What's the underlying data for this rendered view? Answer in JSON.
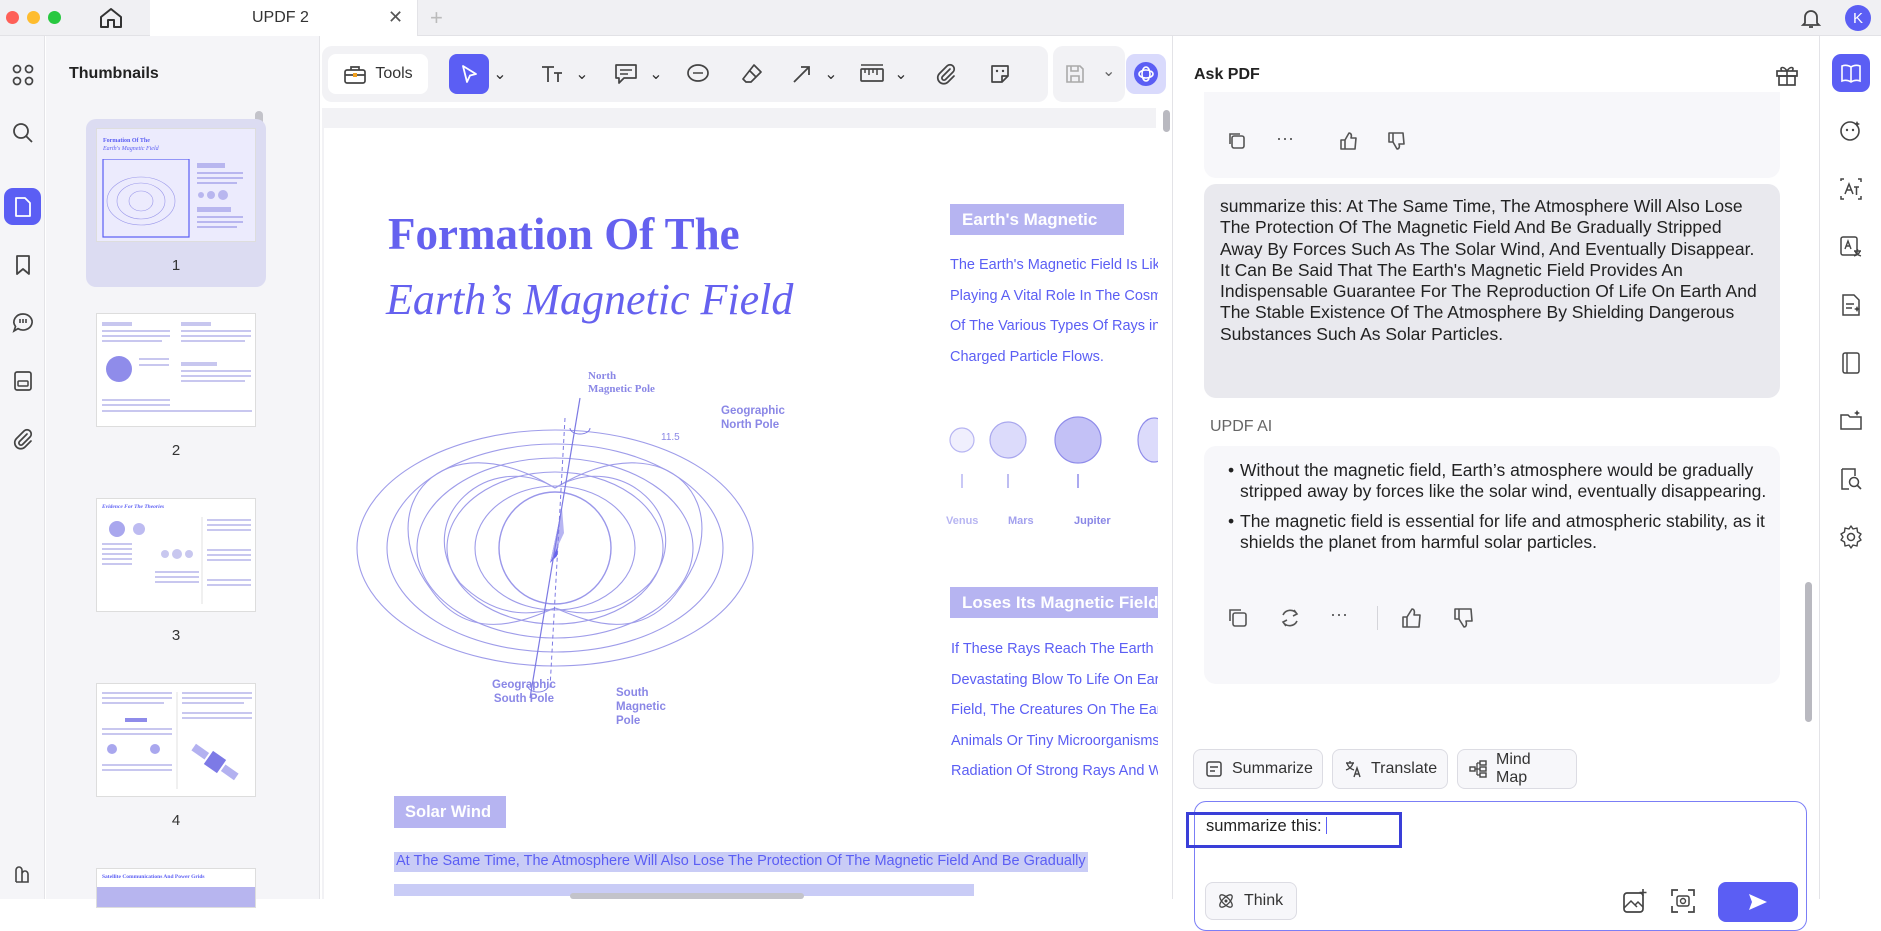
{
  "window": {
    "tab_title": "UPDF 2",
    "avatar_letter": "K"
  },
  "thumbnails": {
    "title": "Thumbnails",
    "pages": [
      "1",
      "2",
      "3",
      "4"
    ],
    "thumb1_title_a": "Formation Of The",
    "thumb1_title_b": "Earth's Magnetic Field",
    "thumb3_title": "Evidence For The Theories",
    "thumb5_title": "Satellite Communications And Power Grids"
  },
  "toolbar": {
    "tools_label": "Tools"
  },
  "document": {
    "title_line1": "Formation Of The",
    "title_line2": "Earth’s Magnetic Field",
    "diagram_labels": {
      "north_magnetic_pole": [
        "North",
        "Magnetic Pole"
      ],
      "geographic_north_pole": [
        "Geographic",
        "North Pole"
      ],
      "angle": "11.5",
      "geographic_south_pole": [
        "Geographic",
        "South Pole"
      ],
      "south_magnetic_pole": [
        "South",
        "Magnetic",
        "Pole"
      ]
    },
    "earths_magnetic_heading": "Earth's Magnetic",
    "earths_magnetic_lines": [
      "The Earth's Magnetic Field Is Like",
      "Playing A Vital Role In The Cosm",
      "Of The Various Types Of Rays in",
      "Charged Particle Flows."
    ],
    "planets": [
      "Venus",
      "Mars",
      "Jupiter"
    ],
    "loses_heading": "Loses Its Magnetic Field",
    "loses_lines": [
      "If These Rays Reach The Earth W",
      "Devastating Blow To Life On Ear",
      "Field, The Creatures On The Ear",
      "Animals Or Tiny Microorganisms,",
      "Radiation Of Strong Rays And W"
    ],
    "solar_wind_heading": "Solar Wind",
    "selected_line": "At The Same Time, The Atmosphere Will Also Lose The Protection Of The Magnetic Field And Be Gradually"
  },
  "ai": {
    "title": "Ask PDF",
    "user_message": "summarize this: At The Same Time, The Atmosphere Will Also Lose The Protection Of The Magnetic Field And Be Gradually Stripped Away By Forces Such As The Solar Wind, And Eventually Disappear. It Can Be Said That The Earth's Magnetic Field Provides An Indispensable Guarantee For The Reproduction Of Life On Earth And The Stable Existence Of The Atmosphere By Shielding Dangerous Substances Such As Solar Particles.",
    "assistant_name": "UPDF AI",
    "bullets": [
      "Without the magnetic field, Earth’s atmosphere would be gradually stripped away by forces like the solar wind, eventually disappearing.",
      "The magnetic field is essential for life and atmospheric stability, as it shields the planet from harmful solar particles."
    ],
    "quick_actions": [
      "Summarize",
      "Translate",
      "Mind Map"
    ],
    "input_value": "summarize this:",
    "think_label": "Think"
  },
  "colors": {
    "accent": "#5b5ef4",
    "doc_blue": "#6a63f0",
    "highlight": "#c9ccf6",
    "selection_box": "#3a3fd8"
  }
}
